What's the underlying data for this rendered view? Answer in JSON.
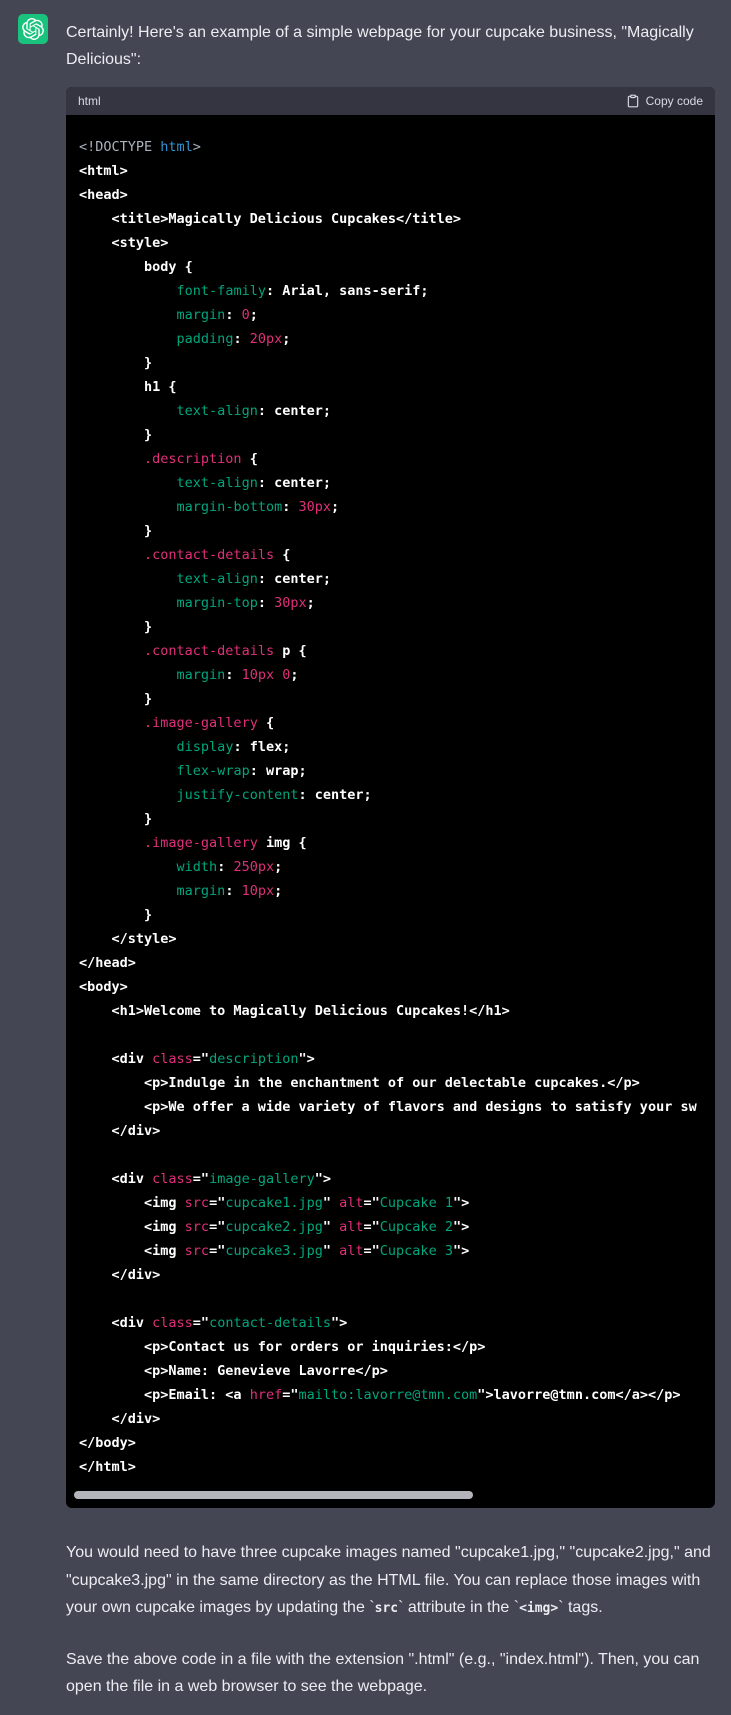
{
  "message": {
    "avatar": {
      "icon": "openai-logo-icon",
      "bg_color": "#19c37d"
    },
    "intro_text": "Certainly! Here's an example of a simple webpage for your cupcake business, \"Magically Delicious\":"
  },
  "code_block": {
    "language_label": "html",
    "copy_button": {
      "label": "Copy code",
      "icon": "clipboard-icon"
    },
    "colors": {
      "header_bg": "#343541",
      "body_bg": "#000000",
      "plain": "#ffffff",
      "gray": "#abb2bf",
      "blue": "#2e95d3",
      "green": "#00a67d",
      "pink": "#df3079",
      "scrollbar": "#b4b4bb"
    },
    "has_horizontal_scrollbar": true,
    "lines": [
      [
        [
          "y",
          "<!DOCTYPE "
        ],
        [
          "b",
          "html"
        ],
        [
          "y",
          ">"
        ]
      ],
      [
        [
          "w",
          "<html>"
        ]
      ],
      [
        [
          "w",
          "<head>"
        ]
      ],
      [
        [
          "w",
          "    <title>Magically Delicious Cupcakes</title>"
        ]
      ],
      [
        [
          "w",
          "    <style>"
        ]
      ],
      [
        [
          "w",
          "        body {"
        ]
      ],
      [
        [
          "w",
          "            "
        ],
        [
          "g",
          "font-family"
        ],
        [
          "w",
          ": Arial, sans-serif;"
        ]
      ],
      [
        [
          "w",
          "            "
        ],
        [
          "g",
          "margin"
        ],
        [
          "w",
          ": "
        ],
        [
          "p",
          "0"
        ],
        [
          "w",
          ";"
        ]
      ],
      [
        [
          "w",
          "            "
        ],
        [
          "g",
          "padding"
        ],
        [
          "w",
          ": "
        ],
        [
          "p",
          "20px"
        ],
        [
          "w",
          ";"
        ]
      ],
      [
        [
          "w",
          "        }"
        ]
      ],
      [
        [
          "w",
          "        h1 {"
        ]
      ],
      [
        [
          "w",
          "            "
        ],
        [
          "g",
          "text-align"
        ],
        [
          "w",
          ": center;"
        ]
      ],
      [
        [
          "w",
          "        }"
        ]
      ],
      [
        [
          "w",
          "        "
        ],
        [
          "p",
          ".description"
        ],
        [
          "w",
          " {"
        ]
      ],
      [
        [
          "w",
          "            "
        ],
        [
          "g",
          "text-align"
        ],
        [
          "w",
          ": center;"
        ]
      ],
      [
        [
          "w",
          "            "
        ],
        [
          "g",
          "margin-bottom"
        ],
        [
          "w",
          ": "
        ],
        [
          "p",
          "30px"
        ],
        [
          "w",
          ";"
        ]
      ],
      [
        [
          "w",
          "        }"
        ]
      ],
      [
        [
          "w",
          "        "
        ],
        [
          "p",
          ".contact-details"
        ],
        [
          "w",
          " {"
        ]
      ],
      [
        [
          "w",
          "            "
        ],
        [
          "g",
          "text-align"
        ],
        [
          "w",
          ": center;"
        ]
      ],
      [
        [
          "w",
          "            "
        ],
        [
          "g",
          "margin-top"
        ],
        [
          "w",
          ": "
        ],
        [
          "p",
          "30px"
        ],
        [
          "w",
          ";"
        ]
      ],
      [
        [
          "w",
          "        }"
        ]
      ],
      [
        [
          "w",
          "        "
        ],
        [
          "p",
          ".contact-details"
        ],
        [
          "w",
          " p {"
        ]
      ],
      [
        [
          "w",
          "            "
        ],
        [
          "g",
          "margin"
        ],
        [
          "w",
          ": "
        ],
        [
          "p",
          "10px"
        ],
        [
          "w",
          " "
        ],
        [
          "p",
          "0"
        ],
        [
          "w",
          ";"
        ]
      ],
      [
        [
          "w",
          "        }"
        ]
      ],
      [
        [
          "w",
          "        "
        ],
        [
          "p",
          ".image-gallery"
        ],
        [
          "w",
          " {"
        ]
      ],
      [
        [
          "w",
          "            "
        ],
        [
          "g",
          "display"
        ],
        [
          "w",
          ": flex;"
        ]
      ],
      [
        [
          "w",
          "            "
        ],
        [
          "g",
          "flex-wrap"
        ],
        [
          "w",
          ": wrap;"
        ]
      ],
      [
        [
          "w",
          "            "
        ],
        [
          "g",
          "justify-content"
        ],
        [
          "w",
          ": center;"
        ]
      ],
      [
        [
          "w",
          "        }"
        ]
      ],
      [
        [
          "w",
          "        "
        ],
        [
          "p",
          ".image-gallery"
        ],
        [
          "w",
          " img {"
        ]
      ],
      [
        [
          "w",
          "            "
        ],
        [
          "g",
          "width"
        ],
        [
          "w",
          ": "
        ],
        [
          "p",
          "250px"
        ],
        [
          "w",
          ";"
        ]
      ],
      [
        [
          "w",
          "            "
        ],
        [
          "g",
          "margin"
        ],
        [
          "w",
          ": "
        ],
        [
          "p",
          "10px"
        ],
        [
          "w",
          ";"
        ]
      ],
      [
        [
          "w",
          "        }"
        ]
      ],
      [
        [
          "w",
          "    </style>"
        ]
      ],
      [
        [
          "w",
          "</head>"
        ]
      ],
      [
        [
          "w",
          "<body>"
        ]
      ],
      [
        [
          "w",
          "    <h1>Welcome to Magically Delicious Cupcakes!</h1>"
        ]
      ],
      [],
      [
        [
          "w",
          "    <div "
        ],
        [
          "p",
          "class"
        ],
        [
          "w",
          "=\""
        ],
        [
          "g",
          "description"
        ],
        [
          "w",
          "\">"
        ]
      ],
      [
        [
          "w",
          "        <p>Indulge in the enchantment of our delectable cupcakes.</p>"
        ]
      ],
      [
        [
          "w",
          "        <p>We offer a wide variety of flavors and designs to satisfy your sw"
        ]
      ],
      [
        [
          "w",
          "    </div>"
        ]
      ],
      [],
      [
        [
          "w",
          "    <div "
        ],
        [
          "p",
          "class"
        ],
        [
          "w",
          "=\""
        ],
        [
          "g",
          "image-gallery"
        ],
        [
          "w",
          "\">"
        ]
      ],
      [
        [
          "w",
          "        <img "
        ],
        [
          "p",
          "src"
        ],
        [
          "w",
          "=\""
        ],
        [
          "g",
          "cupcake1.jpg"
        ],
        [
          "w",
          "\" "
        ],
        [
          "p",
          "alt"
        ],
        [
          "w",
          "=\""
        ],
        [
          "g",
          "Cupcake 1"
        ],
        [
          "w",
          "\">"
        ]
      ],
      [
        [
          "w",
          "        <img "
        ],
        [
          "p",
          "src"
        ],
        [
          "w",
          "=\""
        ],
        [
          "g",
          "cupcake2.jpg"
        ],
        [
          "w",
          "\" "
        ],
        [
          "p",
          "alt"
        ],
        [
          "w",
          "=\""
        ],
        [
          "g",
          "Cupcake 2"
        ],
        [
          "w",
          "\">"
        ]
      ],
      [
        [
          "w",
          "        <img "
        ],
        [
          "p",
          "src"
        ],
        [
          "w",
          "=\""
        ],
        [
          "g",
          "cupcake3.jpg"
        ],
        [
          "w",
          "\" "
        ],
        [
          "p",
          "alt"
        ],
        [
          "w",
          "=\""
        ],
        [
          "g",
          "Cupcake 3"
        ],
        [
          "w",
          "\">"
        ]
      ],
      [
        [
          "w",
          "    </div>"
        ]
      ],
      [],
      [
        [
          "w",
          "    <div "
        ],
        [
          "p",
          "class"
        ],
        [
          "w",
          "=\""
        ],
        [
          "g",
          "contact-details"
        ],
        [
          "w",
          "\">"
        ]
      ],
      [
        [
          "w",
          "        <p>Contact us for orders or inquiries:</p>"
        ]
      ],
      [
        [
          "w",
          "        <p>Name: Genevieve Lavorre</p>"
        ]
      ],
      [
        [
          "w",
          "        <p>Email: <a "
        ],
        [
          "p",
          "href"
        ],
        [
          "w",
          "=\""
        ],
        [
          "g",
          "mailto:lavorre@tmn.com"
        ],
        [
          "w",
          "\">lavorre@tmn.com</a></p>"
        ]
      ],
      [
        [
          "w",
          "    </div>"
        ]
      ],
      [
        [
          "w",
          "</body>"
        ]
      ],
      [
        [
          "w",
          "</html>"
        ]
      ]
    ]
  },
  "outro": {
    "paragraph1_segments": [
      [
        "t",
        "You would need to have three cupcake images named \"cupcake1.jpg,\" \"cupcake2.jpg,\" and \"cupcake3.jpg\" in the same directory as the HTML file. You can replace those images with your own cupcake images by updating the `"
      ],
      [
        "c",
        "src"
      ],
      [
        "t",
        "` attribute in the `"
      ],
      [
        "c",
        "<img>"
      ],
      [
        "t",
        "` tags."
      ]
    ],
    "paragraph2": "Save the above code in a file with the extension \".html\" (e.g., \"index.html\"). Then, you can open the file in a web browser to see the webpage."
  }
}
